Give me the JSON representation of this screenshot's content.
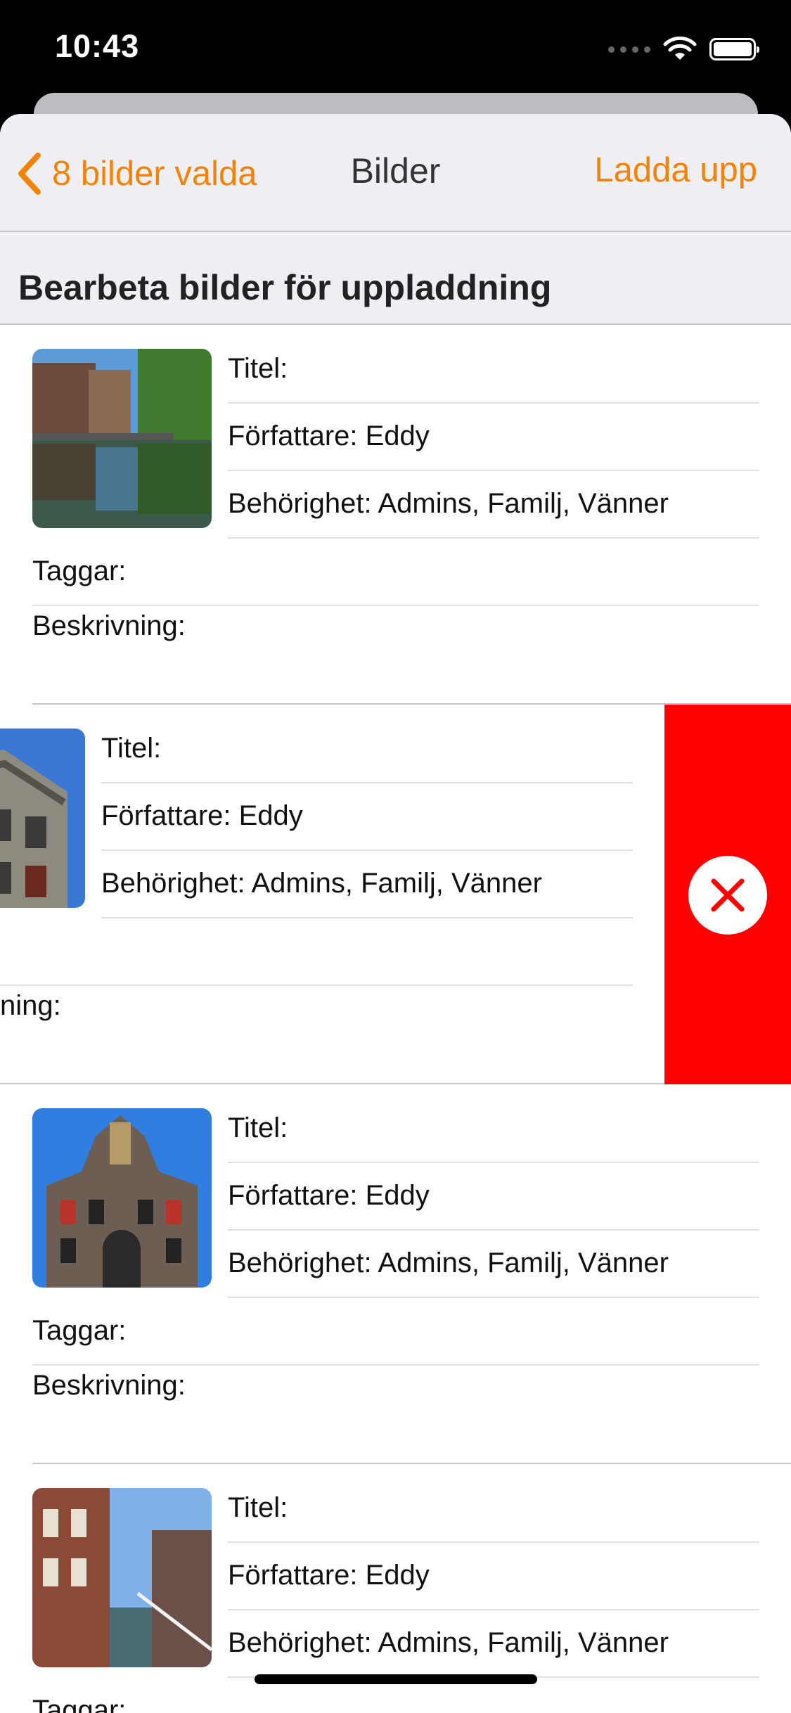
{
  "status_bar": {
    "time": "10:43",
    "icons": [
      "signal-dots-icon",
      "wifi-icon",
      "battery-icon"
    ]
  },
  "navbar": {
    "back_label": "8 bilder valda",
    "title": "Bilder",
    "upload_label": "Ladda upp",
    "accent_color": "#F38306"
  },
  "section": {
    "title": "Bearbeta bilder för uppladdning"
  },
  "items": [
    {
      "photo": "canal-reflection-photo",
      "title_label": "Titel:",
      "author_label": "Författare: Eddy",
      "permission_label": "Behörighet: Admins, Familj, Vänner",
      "tags_label": "Taggar:",
      "description_label": "Beskrivning:"
    },
    {
      "photo": "historic-building-photo",
      "title_label": "Titel:",
      "author_label": "Författare: Eddy",
      "permission_label": "Behörighet: Admins, Familj, Vänner",
      "description_label": "ning:",
      "delete_icon": "close-icon",
      "delete_color": "#FF0000"
    },
    {
      "photo": "town-hall-photo",
      "title_label": "Titel:",
      "author_label": "Författare: Eddy",
      "permission_label": "Behörighet: Admins, Familj, Vänner",
      "tags_label": "Taggar:",
      "description_label": "Beskrivning:"
    },
    {
      "photo": "canal-street-photo",
      "title_label": "Titel:",
      "author_label": "Författare: Eddy",
      "permission_label": "Behörighet: Admins, Familj, Vänner",
      "tags_label": "Taggar:"
    }
  ]
}
